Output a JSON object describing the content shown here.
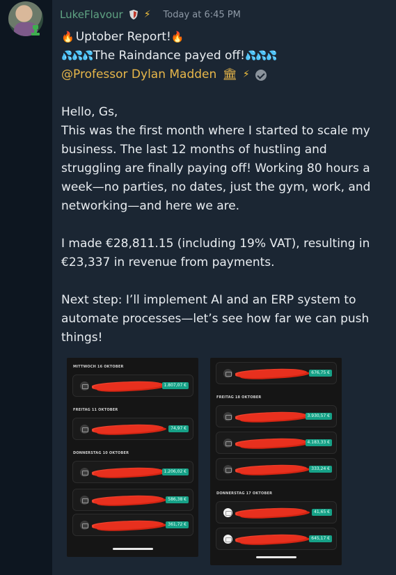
{
  "author": {
    "username": "LukeFlavour",
    "timestamp": "Today at 6:45 PM",
    "username_color": "#5fa383",
    "icons": [
      "shield-icon",
      "bolt-icon"
    ]
  },
  "message": {
    "title": "Uptober Report!",
    "subtitle": "The Raindance payed off!",
    "mention": "@Professor Dylan Madden",
    "greeting": "Hello, Gs,",
    "para1": [
      "This was the first month where I started to scale my",
      "business. The last 12 months of hustling and",
      "struggling are finally paying off! Working 80 hours a",
      "week—no parties, no dates, just the gym, work, and",
      "networking—and here we are."
    ],
    "para2": [
      "I made €28,811.15 (including 19% VAT), resulting in",
      "€23,337 in revenue from payments."
    ],
    "para3": [
      "Next step: I’ll implement AI and an ERP system to",
      "automate processes—let’s see how far we can push",
      "things!"
    ]
  },
  "screenshot_left": {
    "sections": [
      {
        "label": "MITTWOCH 16 OKTOBER",
        "amounts": [
          "1.807,07 €"
        ]
      },
      {
        "label": "FREITAG 11 OKTOBER",
        "amounts": [
          "74,97 €"
        ]
      },
      {
        "label": "DONNERSTAG 10 OKTOBER",
        "amounts": [
          "1.206,02 €",
          "586,38 €",
          "361,72 €"
        ]
      }
    ]
  },
  "screenshot_right": {
    "top_amount": "676,75 €",
    "sections": [
      {
        "label": "FREITAG 18 OKTOBER",
        "amounts": [
          "3.930,57 €",
          "4.183,33 €",
          "333,24 €"
        ]
      },
      {
        "label": "DONNERSTAG 17 OKTOBER",
        "amounts": [
          "41,65 €",
          "645,17 €"
        ]
      }
    ]
  },
  "colors": {
    "message_bg": "#1b2633",
    "mention": "#e8b74a",
    "amount_badge": "#16a187",
    "redaction": "#e8301e"
  }
}
